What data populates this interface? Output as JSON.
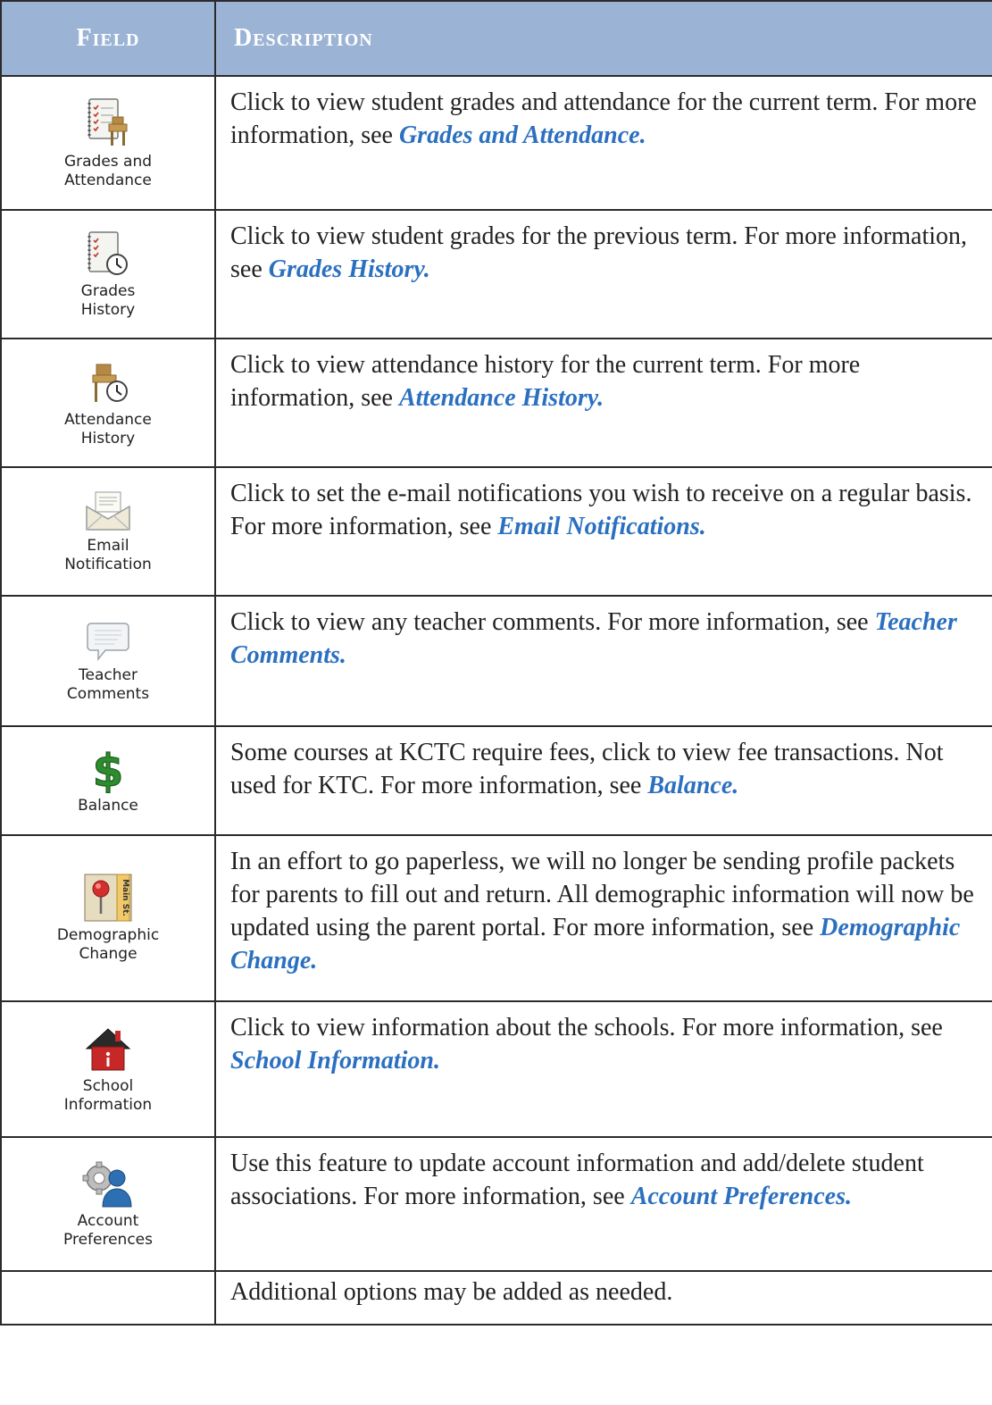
{
  "header": {
    "field": "Field",
    "description": "Description"
  },
  "rows": [
    {
      "label_line1": "Grades and",
      "label_line2": "Attendance",
      "icon": "grades-attendance-icon",
      "text": "Click to view student grades and attendance for the current term.  For more information, see ",
      "link": "Grades and Attendance."
    },
    {
      "label_line1": "Grades",
      "label_line2": "History",
      "icon": "grades-history-icon",
      "text": "Click to view student grades for the previous term.  For more information, see ",
      "link": "Grades History."
    },
    {
      "label_line1": "Attendance",
      "label_line2": "History",
      "icon": "attendance-history-icon",
      "text": "Click to view attendance history for the current term.  For more information, see ",
      "link": "Attendance History."
    },
    {
      "label_line1": "Email",
      "label_line2": "Notification",
      "icon": "email-notification-icon",
      "text": "Click to set the e-mail notifications you wish to receive on a regular basis.  For more information, see ",
      "link": "Email Notifications."
    },
    {
      "label_line1": "Teacher",
      "label_line2": "Comments",
      "icon": "teacher-comments-icon",
      "text": "Click to view any teacher comments.  For more information, see ",
      "link": "Teacher Comments."
    },
    {
      "label_line1": "Balance",
      "label_line2": "",
      "icon": "dollar-sign-icon",
      "text": "Some courses at KCTC require fees, click to view fee transactions.  Not used for KTC.  For more information, see ",
      "link": "Balance."
    },
    {
      "label_line1": "Demographic",
      "label_line2": "Change",
      "icon": "map-pin-street-icon",
      "icon_text": "Main St.",
      "text": "In an effort to go paperless, we will no longer be sending profile packets for parents to fill out and return.  All demographic information will now be updated using the parent portal.  For more information, see ",
      "link": "Demographic Change."
    },
    {
      "label_line1": "School",
      "label_line2": "Information",
      "icon": "school-house-icon",
      "text": "Click to view information about the schools.  For more information, see ",
      "link": "School Information."
    },
    {
      "label_line1": "Account",
      "label_line2": "Preferences",
      "icon": "gear-user-icon",
      "text": "Use this feature to update account information and add/delete student associations.  For more information, see ",
      "link": "Account Preferences."
    },
    {
      "label_line1": "",
      "label_line2": "",
      "icon": "",
      "text": "Additional options may be added as needed.",
      "link": ""
    }
  ]
}
